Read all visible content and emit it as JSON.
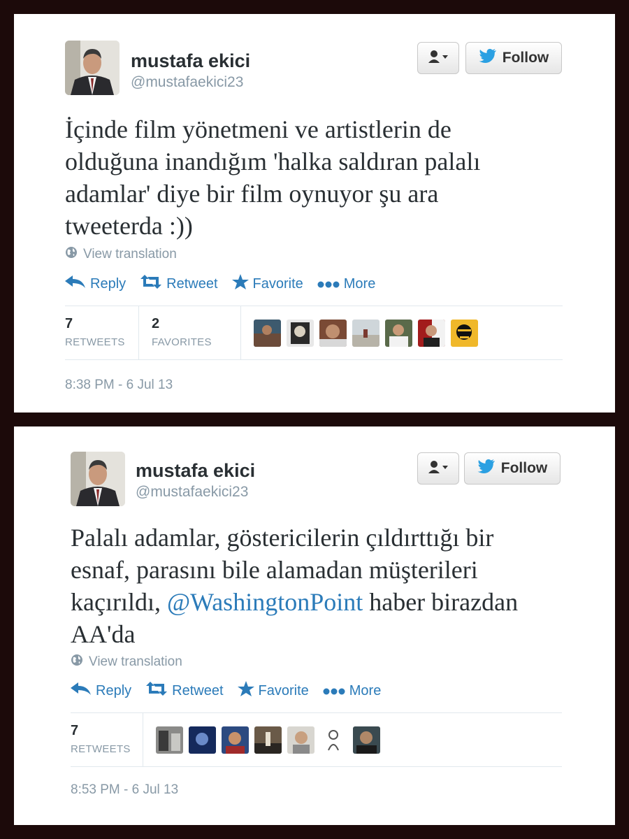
{
  "colors": {
    "frame": "#1c0a0a",
    "link_blue": "#2b7bb9",
    "muted": "#8899a6",
    "text": "#292f33"
  },
  "tweets": [
    {
      "author_name": "mustafa ekici",
      "author_handle": "@mustafaekici23",
      "follow_label": "Follow",
      "text_lines": [
        "İçinde film yönetmeni ve artistlerin de",
        "olduğuna inandığım 'halka saldıran palalı",
        "adamlar' diye bir film oynuyor şu ara",
        "tweeterda :))"
      ],
      "view_translation": "View translation",
      "actions": {
        "reply": "Reply",
        "retweet": "Retweet",
        "favorite": "Favorite",
        "more": "More"
      },
      "stats": {
        "retweets_count": "7",
        "retweets_label": "RETWEETS",
        "favorites_count": "2",
        "favorites_label": "FAVORITES"
      },
      "engager_avatars": 7,
      "timestamp": "8:38 PM - 6 Jul 13"
    },
    {
      "author_name": "mustafa ekici",
      "author_handle": "@mustafaekici23",
      "follow_label": "Follow",
      "text_lines_plain": [
        "Palalı adamlar, göstericilerin çıldırttığı bir",
        "esnaf, parasını bile alamadan müşterileri"
      ],
      "text_line3_before": "kaçırıldı, ",
      "text_mention": "@WashingtonPoint",
      "text_line3_after": " haber birazdan",
      "text_line4": "AA'da",
      "view_translation": "View translation",
      "actions": {
        "reply": "Reply",
        "retweet": "Retweet",
        "favorite": "Favorite",
        "more": "More"
      },
      "stats": {
        "retweets_count": "7",
        "retweets_label": "RETWEETS"
      },
      "engager_avatars": 7,
      "timestamp": "8:53 PM - 6 Jul 13"
    }
  ]
}
